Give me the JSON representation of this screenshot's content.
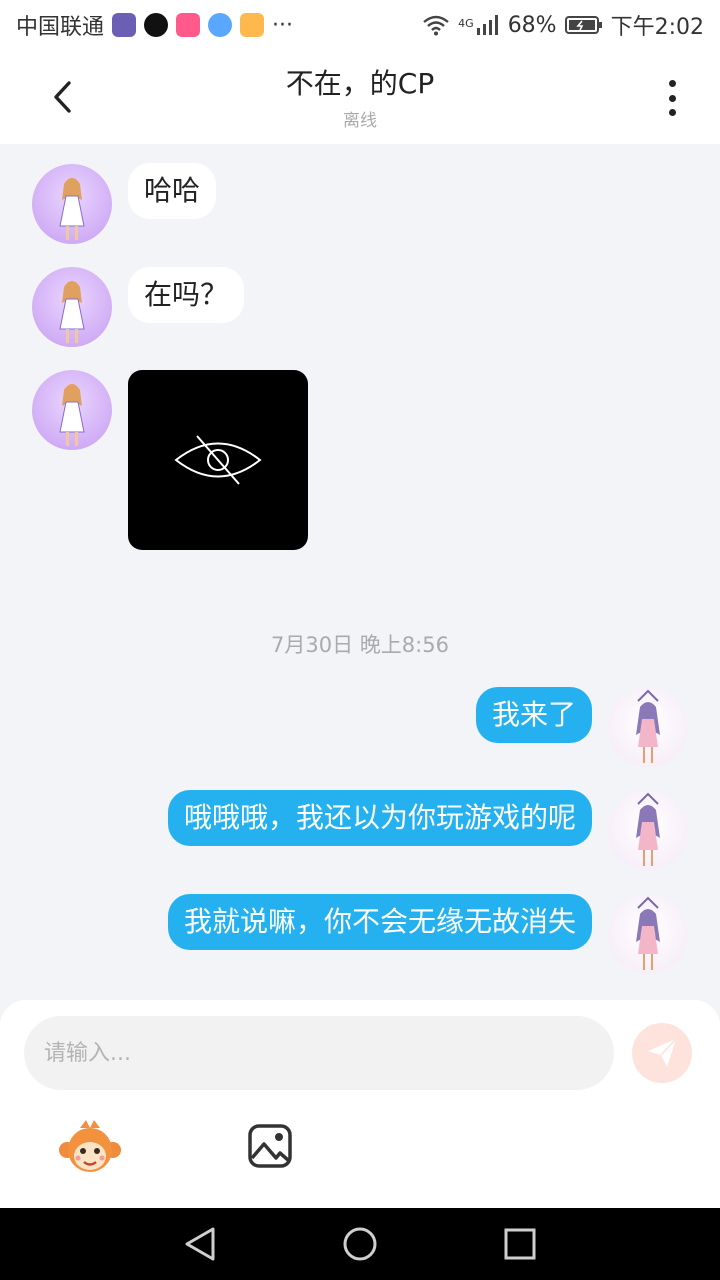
{
  "status_bar": {
    "carrier": "中国联通",
    "more": "···",
    "network": "4G",
    "battery": "68%",
    "time": "下午2:02"
  },
  "header": {
    "title": "不在，的CP",
    "subtitle": "离线"
  },
  "messages": [
    {
      "side": "incoming",
      "type": "text",
      "text": "哈哈"
    },
    {
      "side": "incoming",
      "type": "text",
      "text": "在吗？"
    },
    {
      "side": "incoming",
      "type": "image",
      "icon": "eye-off-icon"
    },
    {
      "side": "outgoing",
      "type": "text",
      "text": "我来了"
    },
    {
      "side": "outgoing",
      "type": "text",
      "text": "哦哦哦，我还以为你玩游戏的呢"
    },
    {
      "side": "outgoing",
      "type": "text",
      "text": "我就说嘛，你不会无缘无故消失"
    }
  ],
  "timestamp": "7月30日 晚上8:56",
  "composer": {
    "placeholder": "请输入...",
    "send_icon": "paper-plane-icon",
    "emoji_icon": "monkey-sticker-icon",
    "image_icon": "image-icon"
  },
  "nav_bar": {
    "back_icon": "triangle-back-icon",
    "home_icon": "circle-home-icon",
    "recents_icon": "square-recents-icon"
  },
  "colors": {
    "outgoing_bubble": "#25b1f0",
    "incoming_bubble": "#ffffff",
    "chat_background": "#f3f4f8",
    "send_button": "#fde3dc"
  }
}
